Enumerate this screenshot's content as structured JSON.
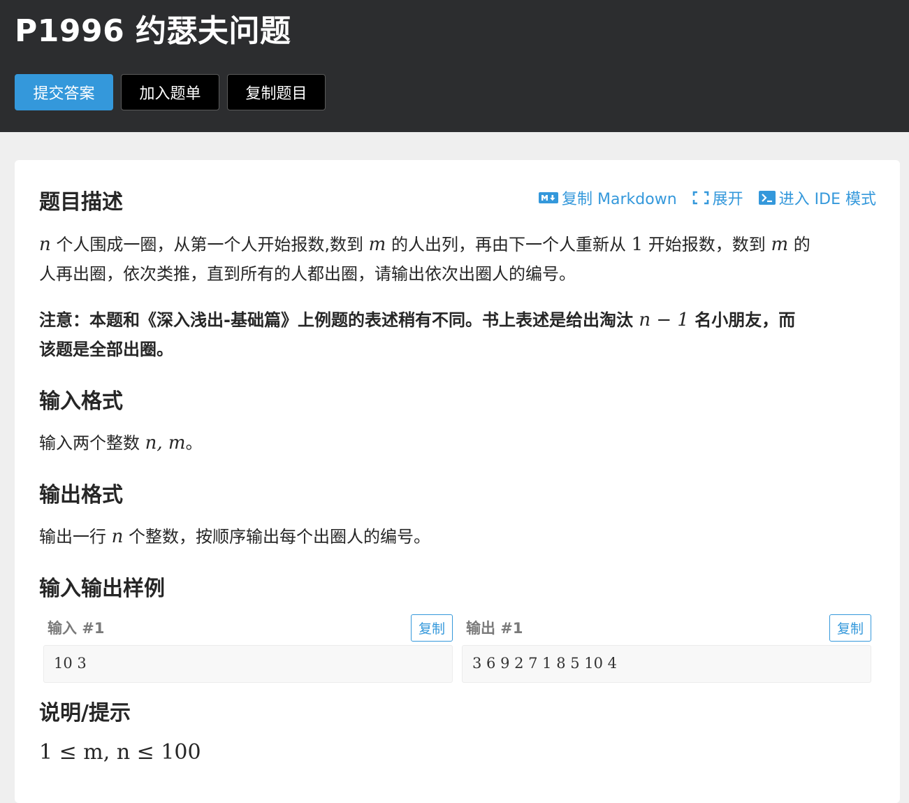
{
  "header": {
    "title": "P1996 约瑟夫问题",
    "buttons": {
      "submit": "提交答案",
      "add_to_list": "加入题单",
      "copy_problem": "复制题目"
    }
  },
  "toolbar": {
    "copy_markdown": "复制 Markdown",
    "expand": "展开",
    "ide_mode": "进入 IDE 模式"
  },
  "sections": {
    "description_title": "题目描述",
    "description_text_1a": "个人围成一圈，从第一个人开始报数,数到",
    "description_text_1b": "的人出列，再由下一个人重新从",
    "description_text_1c": "开始报数，数到",
    "description_text_1d": "的",
    "description_text_2": "人再出圈，依次类推，直到所有的人都出圈，请输出依次出圈人的编号。",
    "note_a": "注意：本题和《深入浅出-基础篇》上例题的表述稍有不同。书上表述是给出淘汰",
    "note_b": "名小朋友，而",
    "note_c": "该题是全部出圈。",
    "input_title": "输入格式",
    "input_text": "输入两个整数",
    "output_title": "输出格式",
    "output_text_a": "输出一行",
    "output_text_b": "个整数，按顺序输出每个出圈人的编号。",
    "samples_title": "输入输出样例",
    "hint_title": "说明/提示"
  },
  "math": {
    "n": "n",
    "m": "m",
    "one": "1",
    "n_minus_1": "n − 1",
    "n_comma_m": "n, m",
    "period": "。",
    "constraint": "1 ≤ m, n ≤ 100"
  },
  "samples": {
    "input_label": "输入 #1",
    "output_label": "输出 #1",
    "copy_label": "复制",
    "input_value": "10 3",
    "output_value": "3 6 9 2 7 1 8 5 10 4"
  },
  "colors": {
    "accent": "#3498db",
    "header_bg": "#2c2d2f"
  }
}
